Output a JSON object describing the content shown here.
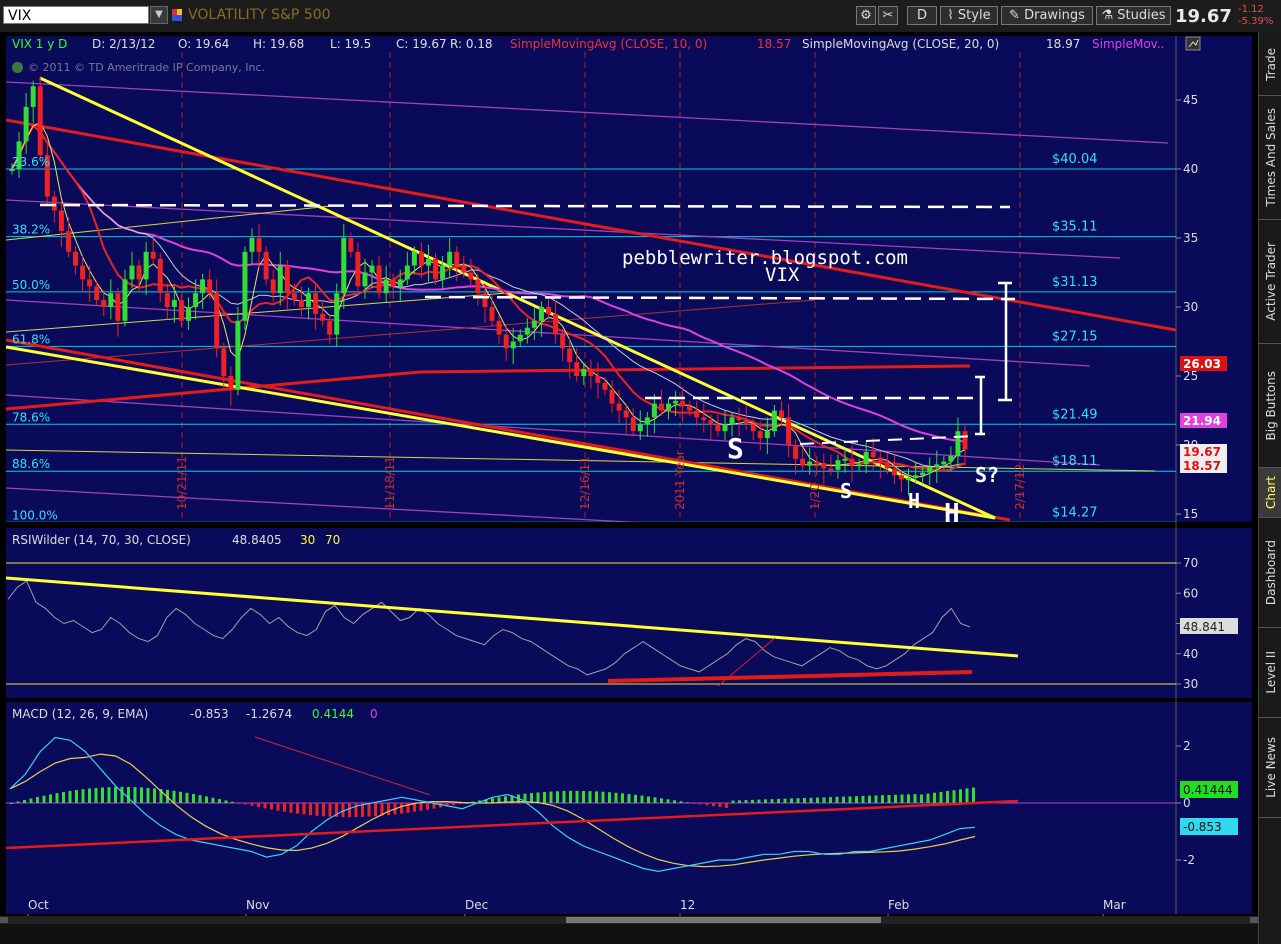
{
  "toolbar": {
    "symbol": "VIX",
    "symbol_title": "VOLATILITY S&P 500",
    "period_button": "D",
    "style_label": "Style",
    "drawings_label": "Drawings",
    "studies_label": "Studies",
    "last_price": "19.67",
    "change": "-1.12",
    "change_pct": "-5.39%"
  },
  "price_header": {
    "symbol_period": "VIX 1 y D",
    "date": "D: 2/13/12",
    "open": "O: 19.64",
    "high": "H: 19.68",
    "low": "L: 19.5",
    "close": "C: 19.67",
    "range": "R: 0.18",
    "sma10_label": "SimpleMovingAvg (CLOSE, 10, 0)",
    "sma10_value": "18.57",
    "sma20_label": "SimpleMovingAvg (CLOSE, 20, 0)",
    "sma20_value": "18.97",
    "sma_more": "SimpleMov..",
    "copyright": "© 2011 © TD Ameritrade IP Company, Inc."
  },
  "fib_levels": [
    {
      "pct": "23.6%",
      "value": "$40.04",
      "price": 40.0
    },
    {
      "pct": "38.2%",
      "value": "$35.11",
      "price": 35.1
    },
    {
      "pct": "50.0%",
      "value": "$31.13",
      "price": 31.1
    },
    {
      "pct": "61.8%",
      "value": "$27.15",
      "price": 27.15
    },
    {
      "pct": "78.6%",
      "value": "$21.49",
      "price": 21.5
    },
    {
      "pct": "88.6%",
      "value": "$18.11",
      "price": 18.1
    },
    {
      "pct": "100.0%",
      "value": "$14.27",
      "price": 14.4
    }
  ],
  "price_axis": [
    "45",
    "40",
    "35",
    "30",
    "25",
    "20",
    "15"
  ],
  "price_badges": {
    "sma_purple": "26.03",
    "sma_mid": "21.94",
    "last": "19.67",
    "sma10": "18.57"
  },
  "annotations": {
    "blog": "pebblewriter.blogspot.com",
    "vix": "VIX",
    "s1": "S",
    "s2": "S",
    "h1": "H",
    "h2": "H",
    "s3": "S?"
  },
  "date_markers": [
    "10/21/11",
    "11/18/11",
    "12/16/11",
    "2011 Year",
    "1/20",
    "2/17/12"
  ],
  "rsi": {
    "label": "RSIWilder (14, 70, 30, CLOSE)",
    "value": "48.8405",
    "ob": "30",
    "os": "70",
    "badge": "48.841",
    "axis": [
      "70",
      "60",
      "50",
      "40",
      "30"
    ]
  },
  "macd": {
    "label": "MACD (12, 26, 9, EMA)",
    "value": "-0.853",
    "avg": "-1.2674",
    "diff": "0.4144",
    "zero": "0",
    "badge_diff": "0.41444",
    "badge_value": "-0.853",
    "axis": [
      "2",
      "0",
      "-2"
    ]
  },
  "x_axis": [
    "Oct",
    "Nov",
    "Dec",
    "12",
    "Feb",
    "Mar"
  ],
  "sidebar_tabs": [
    "Trade",
    "Times And Sales",
    "Active Trader",
    "Big Buttons",
    "Chart",
    "Dashboard",
    "Level II",
    "Live News"
  ],
  "colors": {
    "background": "#0a0a5a",
    "fib_line": "#00cfe0",
    "trend_yellow": "#ffff33",
    "trend_red": "#e41b1b",
    "sma_magenta": "#e040e0",
    "up_candle": "#33dd33",
    "down_candle": "#ee2222"
  }
}
